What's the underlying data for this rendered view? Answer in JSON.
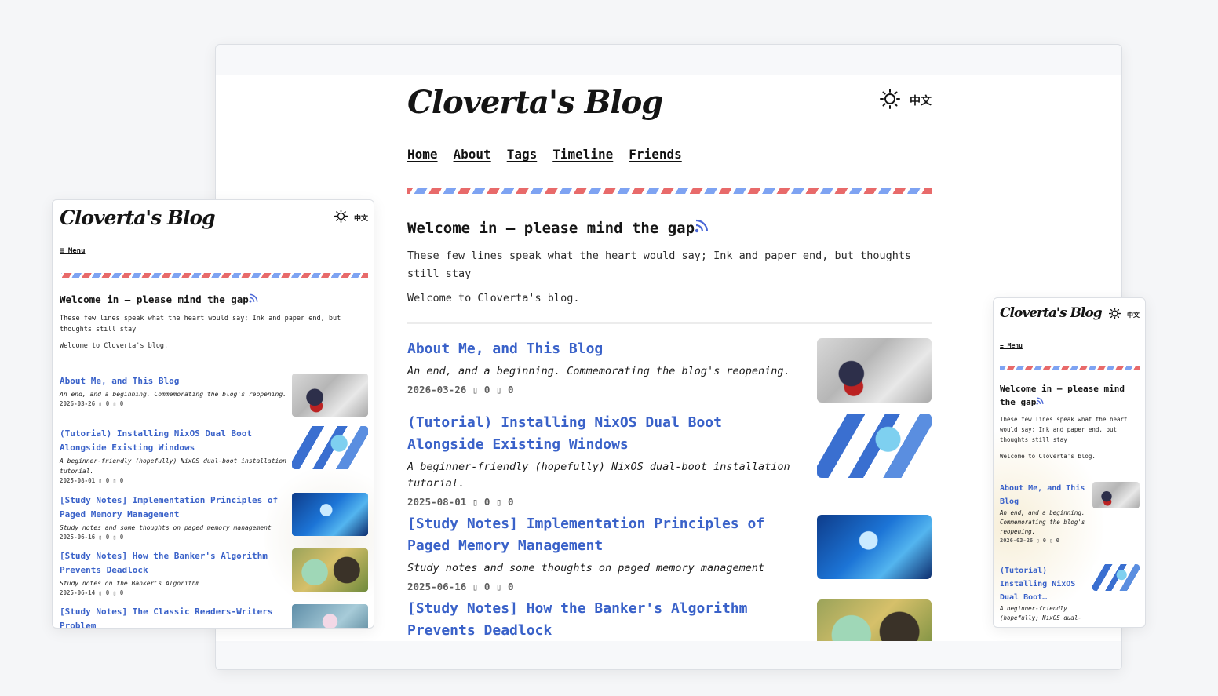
{
  "blog": {
    "logo": "Cloverta's Blog",
    "language_toggle": "中文",
    "theme_icon": "sun-icon",
    "nav": [
      "Home",
      "About",
      "Tags",
      "Timeline",
      "Friends"
    ],
    "menu_label": "≡ Menu",
    "welcome": {
      "title": "Welcome in — please mind the gap",
      "rss_icon": "rss-icon",
      "line1": "These few lines speak what the heart would say; Ink and paper end, but thoughts still stay",
      "line2": "Welcome to Cloverta's blog."
    },
    "posts": [
      {
        "title": "About Me, and This Blog",
        "desc": "An end, and a beginning. Commemorating the blog's reopening.",
        "date": "2026-03-26",
        "meta_rest": " ▯ 0 ▯ 0"
      },
      {
        "title": "(Tutorial) Installing NixOS Dual Boot Alongside Existing Windows",
        "desc": "A beginner-friendly (hopefully) NixOS dual-boot installation tutorial.",
        "date": "2025-08-01",
        "meta_rest": " ▯ 0 ▯ 0"
      },
      {
        "title": "[Study Notes] Implementation Principles of Paged Memory Management",
        "desc": "Study notes and some thoughts on paged memory management",
        "date": "2025-06-16",
        "meta_rest": " ▯ 0 ▯ 0"
      },
      {
        "title": "[Study Notes] How the Banker's Algorithm Prevents Deadlock",
        "desc": "Study notes on the Banker's Algorithm",
        "date": "2025-06-14",
        "meta_rest": " ▯ 0 ▯ 0"
      },
      {
        "title": "[Study Notes] The Classic Readers-Writers Problem"
      }
    ],
    "mobile_right": {
      "welcome_title": "Welcome in — please mind the gap",
      "post1_title": "About Me, and This Blog",
      "post1_desc": "An end, and a beginning. Commemorating the blog's reopening.",
      "post1_date": "2026-03-26",
      "post2_title": "(Tutorial) Installing NixOS Dual Boot…",
      "post2_desc": "A beginner-friendly (hopefully) NixOS dual-"
    }
  },
  "colors": {
    "link": "#3a62c9",
    "airmail_red": "#e86a6a",
    "airmail_blue": "#7ea3f2",
    "rss": "#4a67d6"
  }
}
